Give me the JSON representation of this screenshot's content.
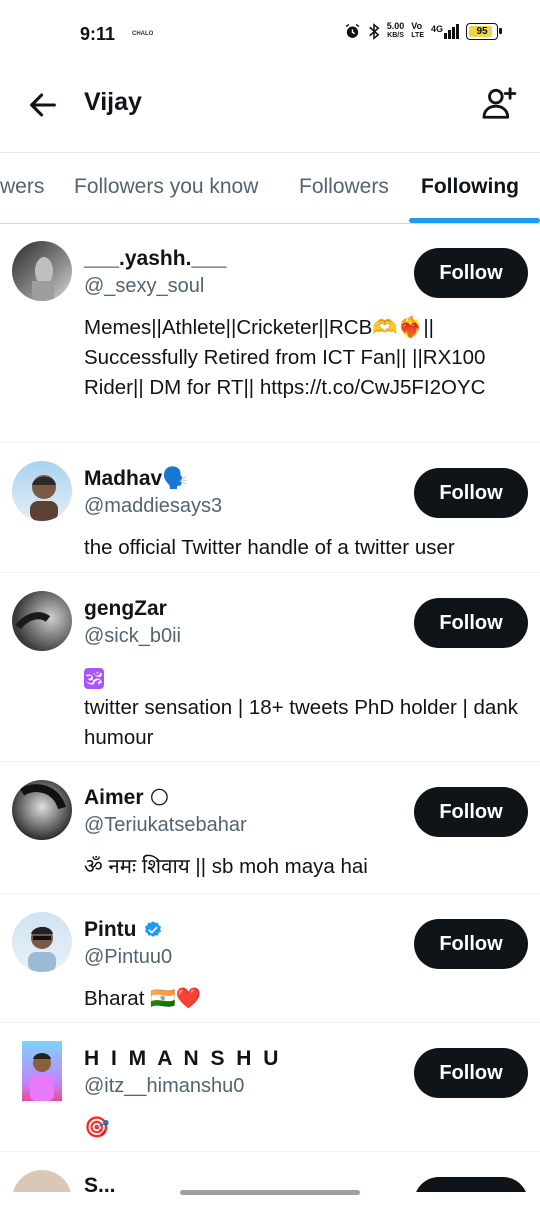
{
  "status_bar": {
    "time": "9:11",
    "mini_text": "CHALO",
    "speed": "5.00",
    "speed_unit": "KB/S",
    "volte_top": "Vo",
    "volte_bottom": "LTE",
    "network": "4G",
    "battery": "95",
    "battery_level": 0.95
  },
  "header": {
    "title": "Vijay",
    "back_icon": "arrow-left-icon",
    "add_user_icon": "add-user-icon"
  },
  "tabs": [
    {
      "label": "wers"
    },
    {
      "label": "Followers you know"
    },
    {
      "label": "Followers"
    },
    {
      "label": "Following"
    }
  ],
  "colors": {
    "accent": "#1d9bf0",
    "button_bg": "#0f1419",
    "secondary_text": "#536471"
  },
  "users": [
    {
      "name": "___.yashh.___",
      "handle": "@_sexy_soul",
      "bio": "Memes||Athlete||Cricketer||RCB🫶❤️‍🔥|| Successfully Retired from ICT Fan|| ||RX100 Rider|| DM for RT|| https://t.co/CwJ5FI2OYC",
      "button": "Follow"
    },
    {
      "name": "Madhav🗣️",
      "handle": "@maddiesays3",
      "bio": "the official Twitter handle of a twitter user",
      "button": "Follow"
    },
    {
      "name": "gengZar",
      "handle": "@sick_b0ii",
      "bio_line1": "🕉",
      "bio": "twitter sensation | 18+ tweets PhD holder | dank humour",
      "button": "Follow"
    },
    {
      "name": "Aimer",
      "name_emoji": "🌕",
      "handle": "@Teriukatsebahar",
      "bio": "ॐ नमः शिवाय || sb moh maya hai",
      "button": "Follow"
    },
    {
      "name": "Pintu",
      "handle": "@Pintuu0",
      "bio": "Bharat 🇮🇳❤️",
      "button": "Follow",
      "verified": true
    },
    {
      "name": "H I M A N S H U",
      "handle": "@itz__himanshu0",
      "bio": "🎯",
      "button": "Follow"
    },
    {
      "name": "S...",
      "button": "Follow"
    }
  ]
}
